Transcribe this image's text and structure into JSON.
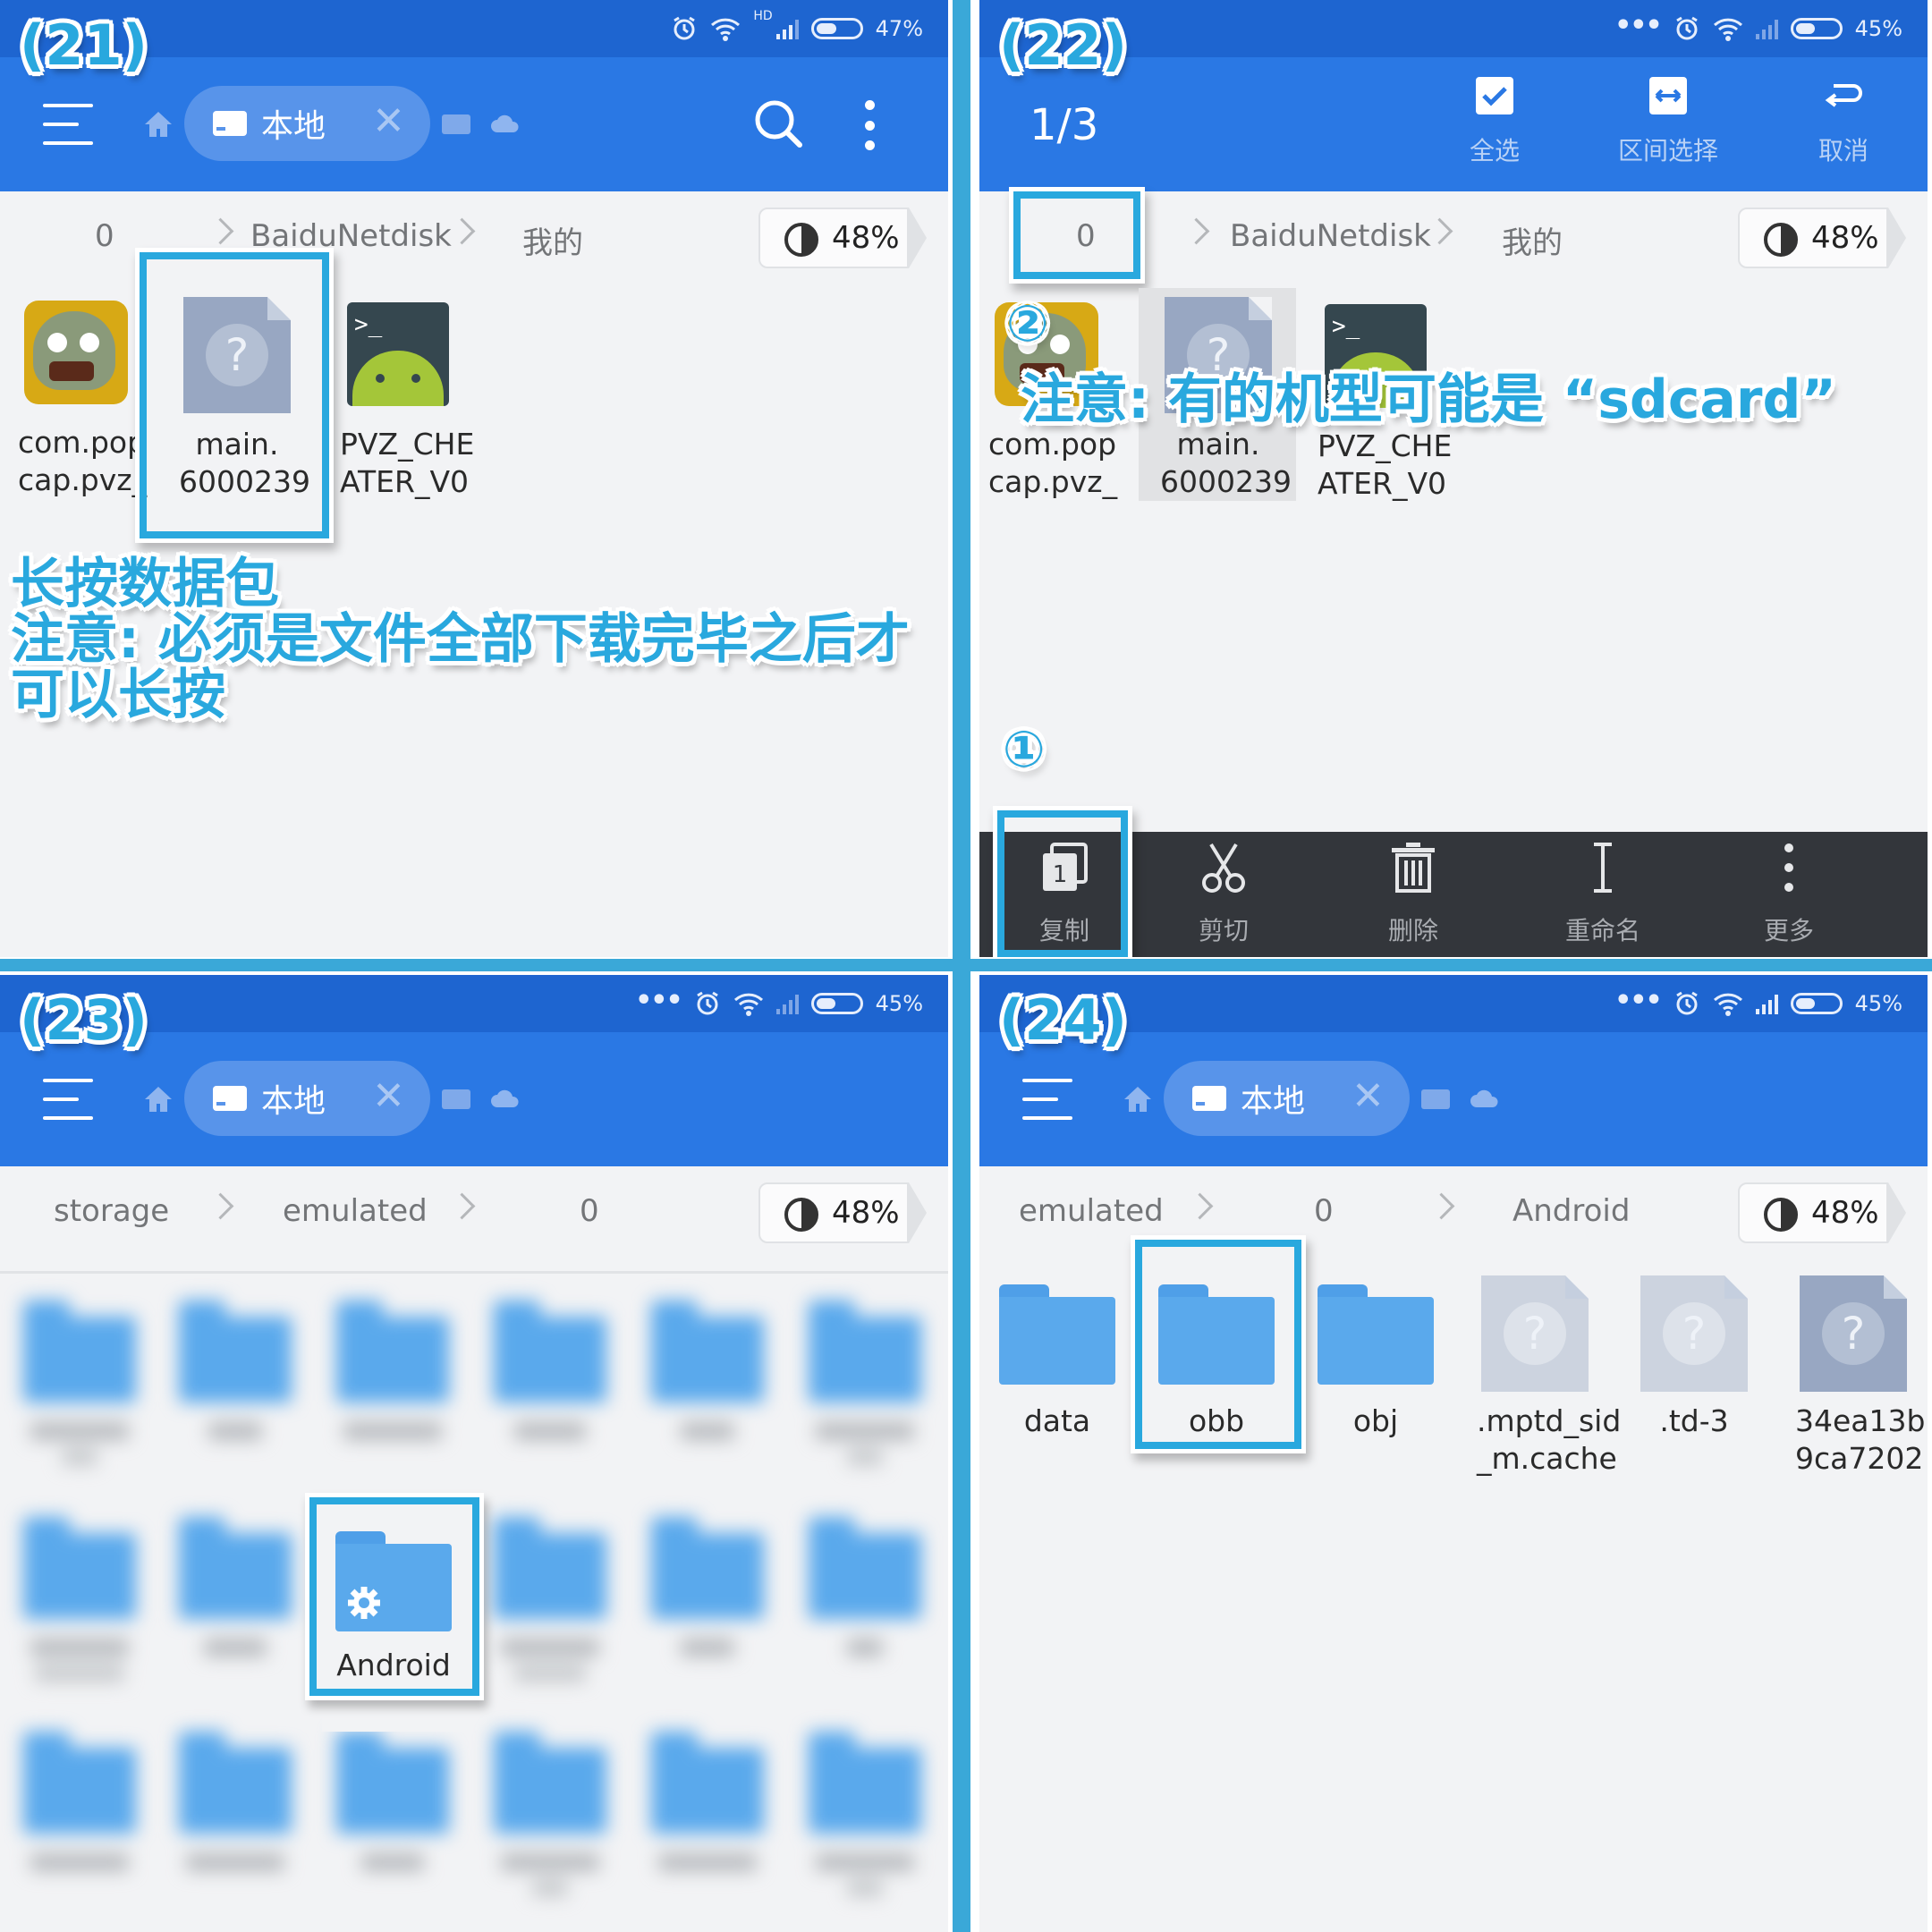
{
  "panels": {
    "p21": {
      "step": "(21)",
      "status": {
        "network": "HD",
        "battery_text": "47%",
        "battery_level": 0.47
      },
      "tab_label": "本地",
      "crumbs": [
        "0",
        "BaiduNetdisk",
        "我的"
      ],
      "usage": "48%",
      "files": [
        {
          "line1": "com.pop",
          "line2": "cap.pvz_"
        },
        {
          "line1": "main.",
          "line2": "6000239"
        },
        {
          "line1": "PVZ_CHE",
          "line2": "ATER_V0"
        }
      ],
      "note": [
        "长按数据包",
        "注意: 必须是文件全部下载完毕之后才",
        "可以长按"
      ]
    },
    "p22": {
      "step": "(22)",
      "status": {
        "battery_text": "45%",
        "battery_level": 0.45
      },
      "selection": "1/3",
      "actions": [
        "全选",
        "区间选择",
        "取消"
      ],
      "crumbs": [
        "0",
        "BaiduNetdisk",
        "我的"
      ],
      "usage": "48%",
      "files": [
        {
          "line1": "com.pop",
          "line2": "cap.pvz_"
        },
        {
          "line1": "main.",
          "line2": "6000239"
        },
        {
          "line1": "PVZ_CHE",
          "line2": "ATER_V0"
        }
      ],
      "marker2": "②",
      "note": "注意: 有的机型可能是 “sdcard”",
      "marker1": "①",
      "bottom": [
        "复制",
        "剪切",
        "删除",
        "重命名",
        "更多"
      ],
      "copy_badge": "1"
    },
    "p23": {
      "step": "(23)",
      "status": {
        "battery_text": "45%",
        "battery_level": 0.45
      },
      "tab_label": "本地",
      "crumbs": [
        "storage",
        "emulated",
        "0"
      ],
      "usage": "48%",
      "highlight_folder": "Android"
    },
    "p24": {
      "step": "(24)",
      "status": {
        "battery_text": "45%",
        "battery_level": 0.45
      },
      "tab_label": "本地",
      "crumbs": [
        "emulated",
        "0",
        "Android"
      ],
      "usage": "48%",
      "items": [
        {
          "line1": "data",
          "line2": ""
        },
        {
          "line1": "obb",
          "line2": ""
        },
        {
          "line1": "obj",
          "line2": ""
        },
        {
          "line1": ".mptd_sid",
          "line2": "_m.cache"
        },
        {
          "line1": ".td-3",
          "line2": ""
        },
        {
          "line1": "34ea13b",
          "line2": "9ca7202"
        }
      ]
    }
  },
  "colors": {
    "accent": "#29a8de",
    "appbar": "#2a78e4",
    "statusbar": "#1e65d0",
    "folder": "#5aa9ec",
    "toolbar": "#33363b"
  }
}
